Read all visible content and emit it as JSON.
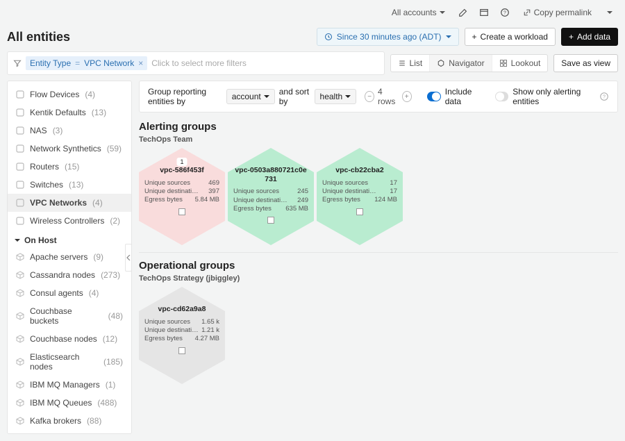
{
  "header": {
    "accounts_label": "All accounts",
    "copy_permalink": "Copy permalink",
    "title": "All entities",
    "time_range": "Since 30 minutes ago (ADT)",
    "create_workload": "Create a workload",
    "add_data": "Add data"
  },
  "filter": {
    "chip_key": "Entity Type",
    "chip_op": "=",
    "chip_val": "VPC Network",
    "placeholder": "Click to select more filters",
    "views": {
      "list": "List",
      "navigator": "Navigator",
      "lookout": "Lookout"
    },
    "save_as_view": "Save as view"
  },
  "sidebar": {
    "items_a": [
      {
        "label": "Flow Devices",
        "count": "(4)"
      },
      {
        "label": "Kentik Defaults",
        "count": "(13)"
      },
      {
        "label": "NAS",
        "count": "(3)"
      },
      {
        "label": "Network Synthetics",
        "count": "(59)"
      },
      {
        "label": "Routers",
        "count": "(15)"
      },
      {
        "label": "Switches",
        "count": "(13)"
      },
      {
        "label": "VPC Networks",
        "count": "(4)",
        "selected": true
      },
      {
        "label": "Wireless Controllers",
        "count": "(2)"
      }
    ],
    "section": "On Host",
    "items_b": [
      {
        "label": "Apache servers",
        "count": "(9)"
      },
      {
        "label": "Cassandra nodes",
        "count": "(273)"
      },
      {
        "label": "Consul agents",
        "count": "(4)"
      },
      {
        "label": "Couchbase buckets",
        "count": "(48)"
      },
      {
        "label": "Couchbase nodes",
        "count": "(12)"
      },
      {
        "label": "Elasticsearch nodes",
        "count": "(185)"
      },
      {
        "label": "IBM MQ Managers",
        "count": "(1)"
      },
      {
        "label": "IBM MQ Queues",
        "count": "(488)"
      },
      {
        "label": "Kafka brokers",
        "count": "(88)"
      }
    ]
  },
  "controls": {
    "group_by_label": "Group reporting entities by",
    "group_by_value": "account",
    "sort_label": "and sort by",
    "sort_value": "health",
    "rows": "4 rows",
    "include_data": "Include data",
    "show_alerting": "Show only alerting entities"
  },
  "alerting": {
    "title": "Alerting groups",
    "group_name": "TechOps Team",
    "hexes": [
      {
        "color": "red",
        "badge": "1",
        "name": "vpc-586f453f",
        "stats": [
          {
            "k": "Unique sources",
            "v": "469"
          },
          {
            "k": "Unique destinati…",
            "v": "397"
          },
          {
            "k": "Egress bytes",
            "v": "5.84 MB"
          }
        ]
      },
      {
        "color": "green",
        "name": "vpc-0503a880721c0e731",
        "stats": [
          {
            "k": "Unique sources",
            "v": "245"
          },
          {
            "k": "Unique destinati…",
            "v": "249"
          },
          {
            "k": "Egress bytes",
            "v": "635 MB"
          }
        ]
      },
      {
        "color": "green",
        "name": "vpc-cb22cba2",
        "stats": [
          {
            "k": "Unique sources",
            "v": "17"
          },
          {
            "k": "Unique destinations",
            "v": "17"
          },
          {
            "k": "Egress bytes",
            "v": "124 MB"
          }
        ]
      }
    ]
  },
  "operational": {
    "title": "Operational groups",
    "group_name": "TechOps Strategy (jbiggley)",
    "hexes": [
      {
        "color": "gray",
        "name": "vpc-cd62a9a8",
        "stats": [
          {
            "k": "Unique sources",
            "v": "1.65 k"
          },
          {
            "k": "Unique destinati…",
            "v": "1.21 k"
          },
          {
            "k": "Egress bytes",
            "v": "4.27 MB"
          }
        ]
      }
    ]
  }
}
